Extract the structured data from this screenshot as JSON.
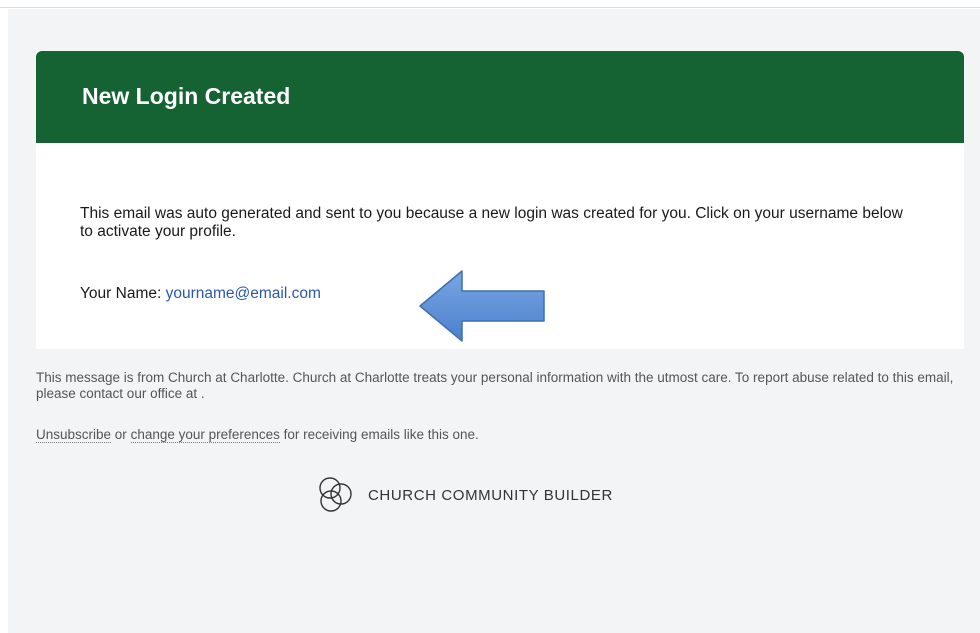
{
  "email": {
    "title": "New Login Created",
    "body": "This email was auto generated and sent to you because a new login was created for you. Click on your username below to activate your profile.",
    "name_label": "Your Name: ",
    "username_link": "yourname@email.com"
  },
  "footer": {
    "notice": "This message is from Church at Charlotte. Church at Charlotte treats your personal information with the utmost care. To report abuse related to this email, please contact our office at .",
    "unsubscribe_label": "Unsubscribe",
    "or_text": " or ",
    "preferences_label": "change your preferences",
    "preferences_suffix": " for receiving emails like this one.",
    "brand_name": "CHURCH COMMUNITY BUILDER"
  },
  "colors": {
    "header": "#156232",
    "link": "#2a57b0",
    "arrow_fill": "#5b8fd6",
    "page_bg": "#f3f4f6"
  },
  "icons": {
    "arrow": "arrow-left-icon",
    "brand_logo": "church-community-builder-logo-icon"
  }
}
